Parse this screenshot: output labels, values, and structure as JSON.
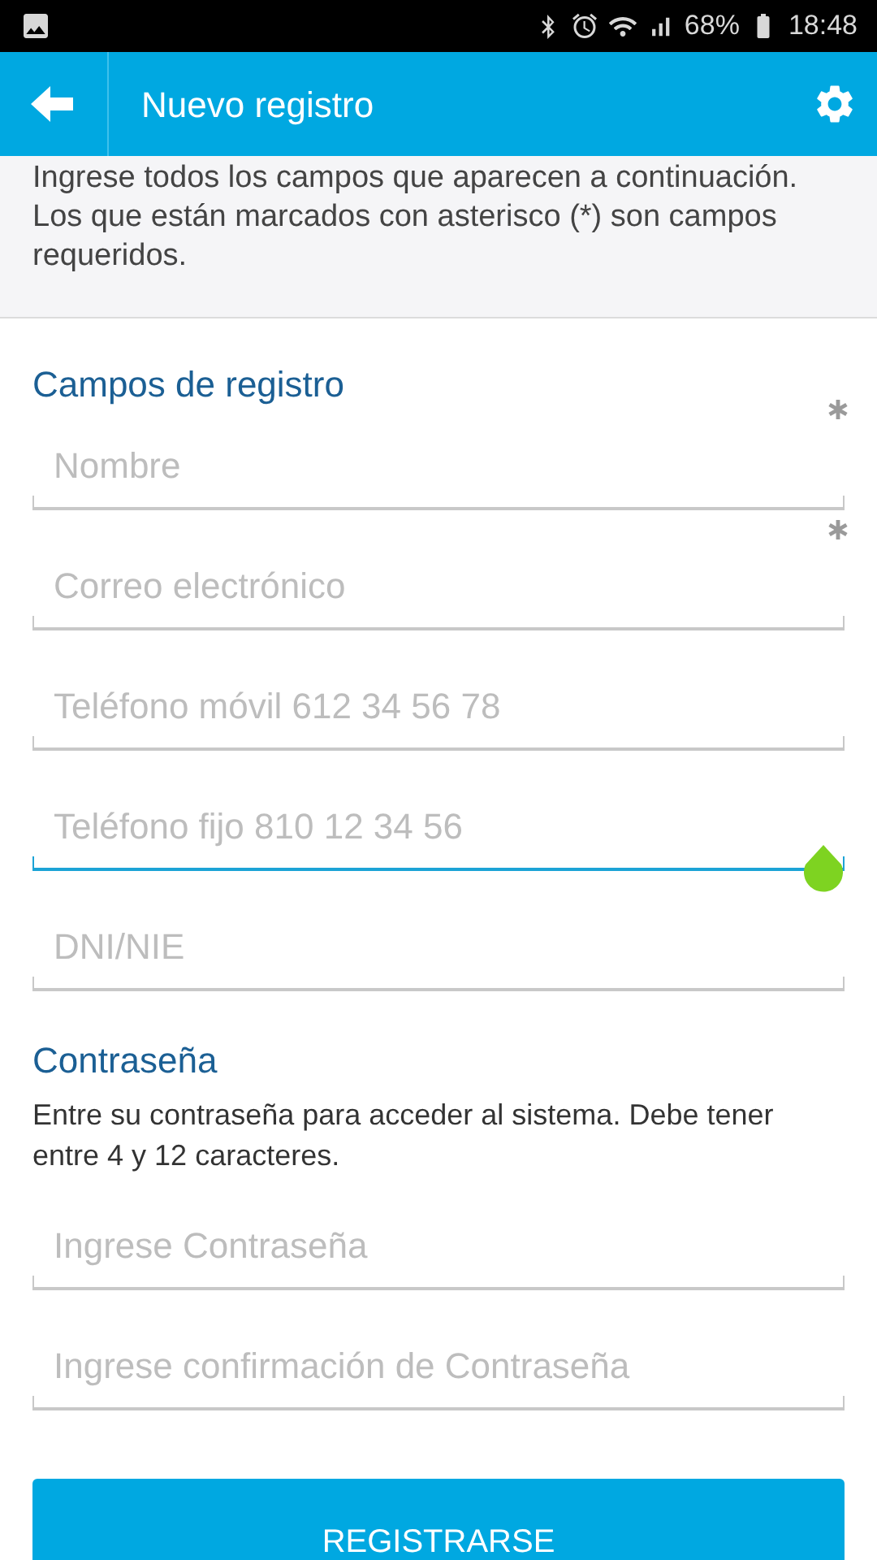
{
  "status_bar": {
    "battery": "68%",
    "time": "18:48"
  },
  "app_bar": {
    "title": "Nuevo registro"
  },
  "intro": "Ingrese todos los campos que aparecen a continuación. Los que están marcados con asterisco (*) son campos requeridos.",
  "sections": [
    {
      "heading": "Campos de registro",
      "fields": [
        {
          "placeholder": "Nombre",
          "required": true,
          "focused": false
        },
        {
          "placeholder": "Correo electrónico",
          "required": true,
          "focused": false
        },
        {
          "placeholder": "Teléfono móvil 612 34 56 78",
          "required": false,
          "focused": false
        },
        {
          "placeholder": "Teléfono fijo 810 12 34 56",
          "required": false,
          "focused": true
        },
        {
          "placeholder": "DNI/NIE",
          "required": false,
          "focused": false
        }
      ]
    },
    {
      "heading": "Contraseña",
      "description": "Entre su contraseña para acceder al sistema. Debe tener entre 4 y 12 caracteres.",
      "fields": [
        {
          "placeholder": "Ingrese Contraseña",
          "required": false,
          "focused": false
        },
        {
          "placeholder": "Ingrese confirmación de Contraseña",
          "required": false,
          "focused": false
        }
      ]
    }
  ],
  "submit_button": "REGISTRARSE"
}
